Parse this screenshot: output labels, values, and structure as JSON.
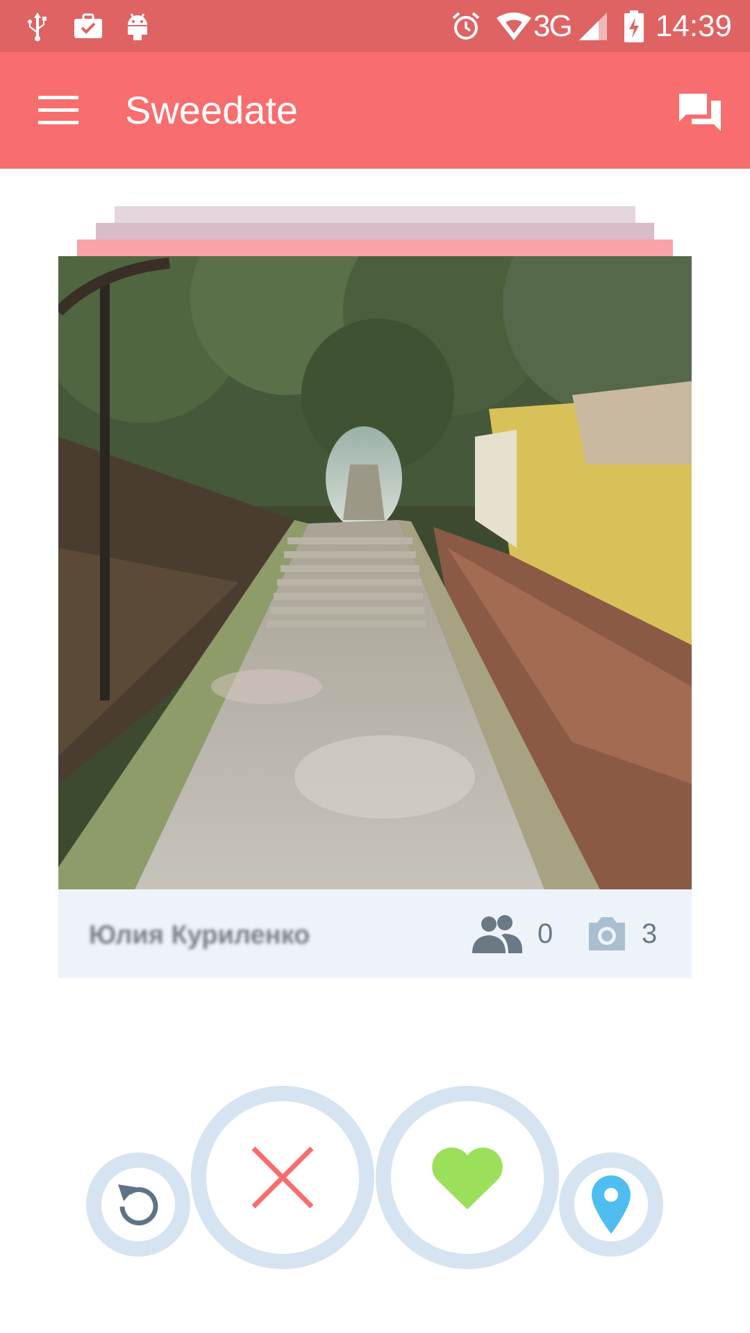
{
  "status_bar": {
    "time": "14:39",
    "network": "3G",
    "icons": [
      "usb-icon",
      "briefcase-check-icon",
      "android-icon",
      "alarm-icon",
      "wifi-icon",
      "signal-icon",
      "battery-charging-icon"
    ]
  },
  "app_bar": {
    "title": "Sweedate",
    "menu_icon": "menu-icon",
    "chat_icon": "chat-icon"
  },
  "card": {
    "profile_name": "Юлия Куриленко",
    "friends_count": "0",
    "photos_count": "3"
  },
  "actions": {
    "undo_icon": "undo-icon",
    "nope_icon": "close-icon",
    "like_icon": "heart-icon",
    "location_icon": "location-pin-icon"
  },
  "colors": {
    "status_bar": "#df6363",
    "app_bar": "#f86d6d",
    "card_footer": "#edf3f9",
    "button_ring": "#d6e4f1",
    "nope": "#f86d6d",
    "like": "#9be05a",
    "location": "#4fbdf0",
    "undo": "#5f7287"
  }
}
